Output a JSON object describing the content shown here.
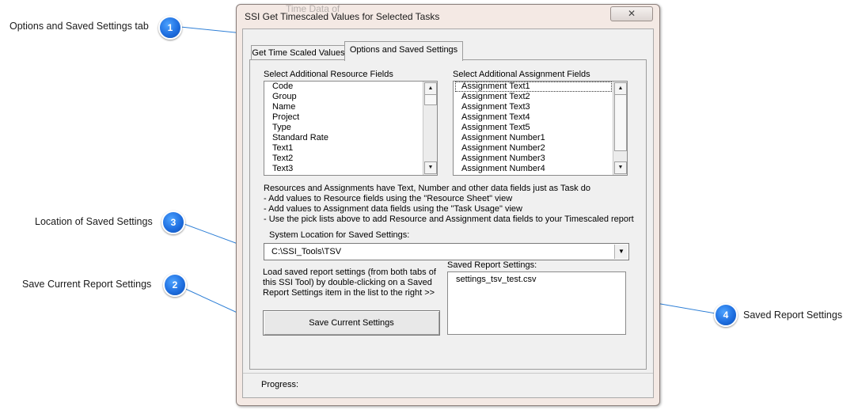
{
  "callouts": [
    {
      "number": "1",
      "label": "Options and Saved Settings tab"
    },
    {
      "number": "3",
      "label": "Location of Saved Settings"
    },
    {
      "number": "2",
      "label": "Save Current Report Settings"
    },
    {
      "number": "4",
      "label": "Saved Report Settings"
    }
  ],
  "window": {
    "title": "SSI Get Timescaled Values for Selected Tasks",
    "title_ghost": "Time Data of",
    "close_icon": "close-icon"
  },
  "tabs": [
    {
      "label": "Get Time Scaled Values"
    },
    {
      "label": "Options and Saved Settings",
      "selected": true
    }
  ],
  "resource_fields": {
    "label": "Select Additional Resource Fields",
    "items": [
      "Code",
      "Group",
      "Name",
      "Project",
      "Type",
      "Standard Rate",
      "Text1",
      "Text2",
      "Text3"
    ]
  },
  "assignment_fields": {
    "label": "Select Additional Assignment Fields",
    "items": [
      "Assignment Text1",
      "Assignment Text2",
      "Assignment Text3",
      "Assignment Text4",
      "Assignment Text5",
      "Assignment Number1",
      "Assignment Number2",
      "Assignment Number3",
      "Assignment Number4"
    ]
  },
  "info_text": [
    "Resources and Assignments have Text, Number and other data fields just as Task do",
    "- Add values to Resource fields using the \"Resource Sheet\" view",
    "- Add values to Assignment data fields using the \"Task Usage\" view",
    "- Use the pick lists above to add Resource and Assignment data fields to your Timescaled report"
  ],
  "location": {
    "label": "System Location for Saved Settings:",
    "value": "C:\\SSI_Tools\\TSV"
  },
  "load_text": [
    "Load saved report settings (from both tabs of",
    "this SSI Tool) by double-clicking on a Saved",
    "Report Settings item in the list to the right >>"
  ],
  "saved_settings": {
    "label": "Saved Report Settings:",
    "items": [
      "settings_tsv_test.csv"
    ]
  },
  "save_button": {
    "label": "Save Current Settings"
  },
  "progress": {
    "label": "Progress:"
  },
  "colors": {
    "callout": "#1f6fe0",
    "line": "#2e7fd6"
  }
}
